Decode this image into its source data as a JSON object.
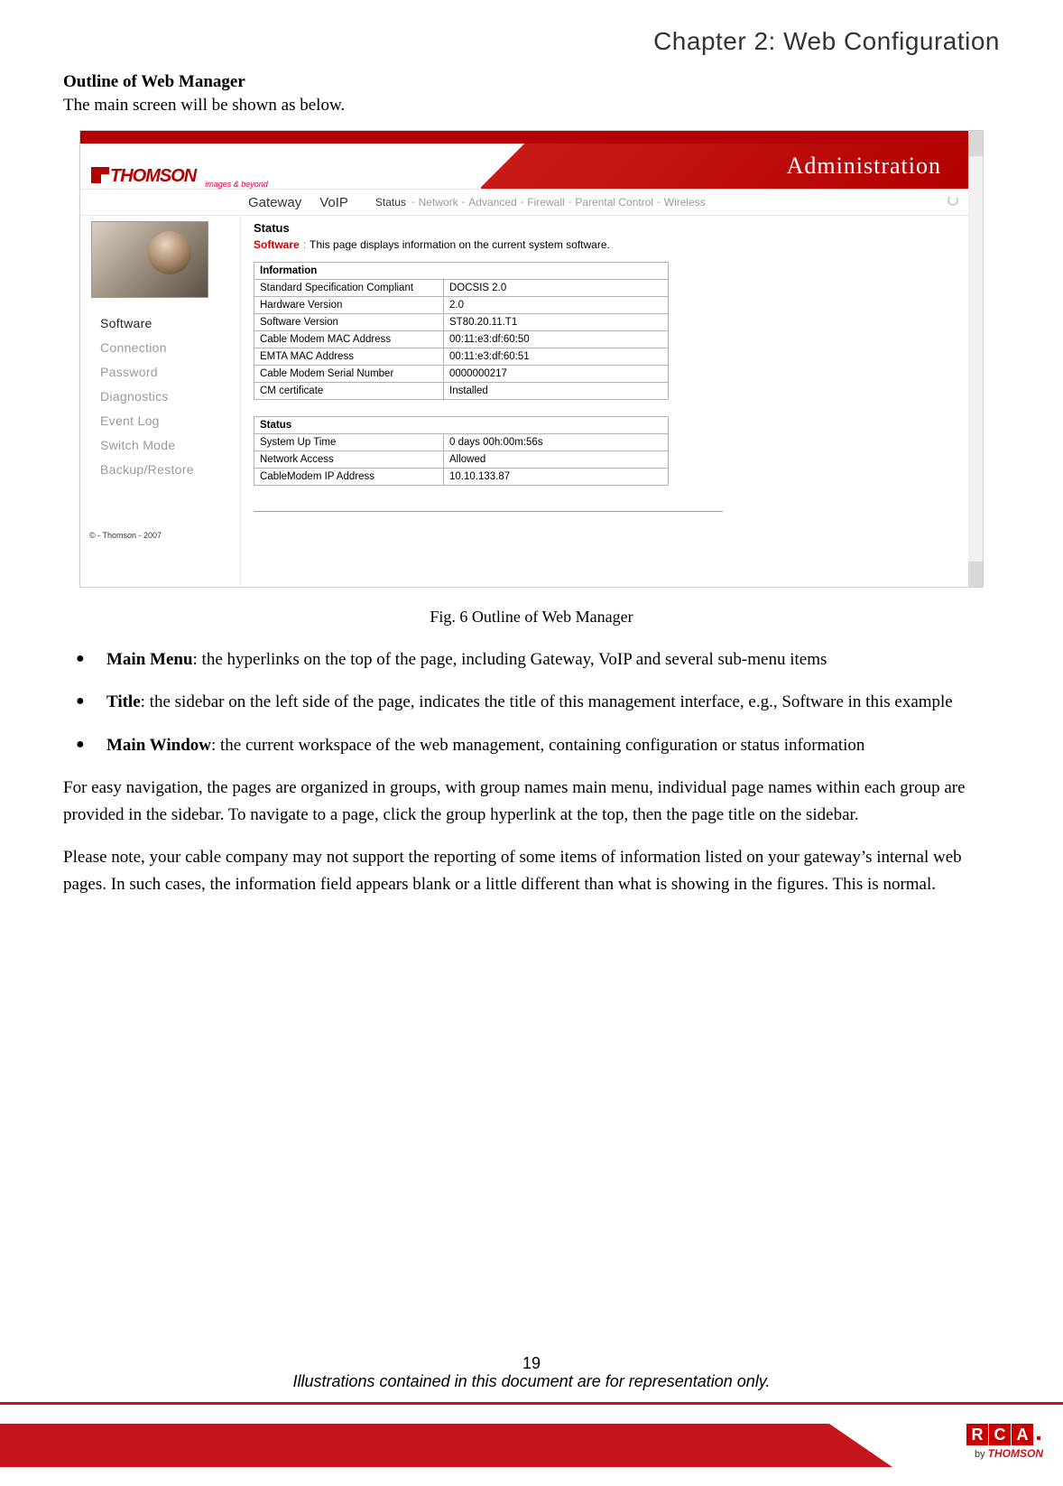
{
  "chapter_title": "Chapter 2: Web Configuration",
  "section_heading": "Outline of Web Manager",
  "intro_text": "The main screen will be shown as below.",
  "screenshot": {
    "logo_text": "THOMSON",
    "tagline": "images & beyond",
    "header_banner": "Administration",
    "main_menu": {
      "gateway": "Gateway",
      "voip": "VoIP"
    },
    "sub_menu": {
      "status": "Status",
      "network": "Network",
      "advanced": "Advanced",
      "firewall": "Firewall",
      "parental": "Parental Control",
      "wireless": "Wireless"
    },
    "page_title": "Status",
    "software_label": "Software",
    "software_desc": "This page displays information on the current system software.",
    "sidebar": {
      "items": [
        {
          "label": "Software",
          "active": true
        },
        {
          "label": "Connection",
          "active": false
        },
        {
          "label": "Password",
          "active": false
        },
        {
          "label": "Diagnostics",
          "active": false
        },
        {
          "label": "Event Log",
          "active": false
        },
        {
          "label": "Switch Mode",
          "active": false
        },
        {
          "label": "Backup/Restore",
          "active": false
        }
      ]
    },
    "info_table": {
      "header": "Information",
      "rows": [
        {
          "k": "Standard Specification Compliant",
          "v": "DOCSIS 2.0"
        },
        {
          "k": "Hardware Version",
          "v": "2.0"
        },
        {
          "k": "Software Version",
          "v": "ST80.20.11.T1"
        },
        {
          "k": "Cable Modem MAC Address",
          "v": "00:11:e3:df:60:50"
        },
        {
          "k": "EMTA MAC Address",
          "v": "00:11:e3:df:60:51"
        },
        {
          "k": "Cable Modem Serial Number",
          "v": "0000000217"
        },
        {
          "k": "CM certificate",
          "v": "Installed"
        }
      ]
    },
    "status_table": {
      "header": "Status",
      "rows": [
        {
          "k": "System Up Time",
          "v": "0 days 00h:00m:56s"
        },
        {
          "k": "Network Access",
          "v": "Allowed"
        },
        {
          "k": "CableModem IP Address",
          "v": "10.10.133.87"
        }
      ]
    },
    "copyright": "© - Thomson - 2007"
  },
  "figure_caption": "Fig. 6 Outline of Web Manager",
  "bullets": [
    {
      "term": "Main Menu",
      "text": ": the hyperlinks on the top of the page, including Gateway, VoIP and several sub-menu items"
    },
    {
      "term": "Title",
      "text": ": the sidebar on the left side of the page, indicates the title of this management interface, e.g., Software in this example"
    },
    {
      "term": "Main Window",
      "text": ": the current workspace of the web management, containing configuration or status information"
    }
  ],
  "para1": "For easy navigation, the pages are organized in groups, with group names main menu, individual page names within each group are provided in the sidebar. To navigate to a page, click the group hyperlink at the top, then the page title on the sidebar.",
  "para2": "Please note, your cable company may not support the reporting of some items of information listed on your gateway’s internal web pages. In such cases, the information field appears blank or a little different than what is showing in the figures. This is normal.",
  "page_number": "19",
  "disclaimer": "Illustrations contained in this document are for representation only.",
  "footer": {
    "rca": "RCA",
    "by": "by",
    "thomson": "THOMSON"
  }
}
